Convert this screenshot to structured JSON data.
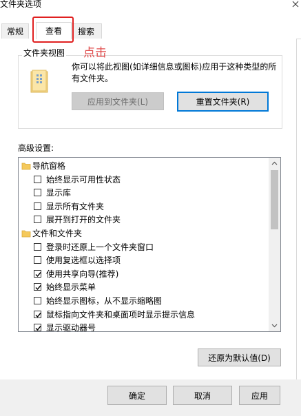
{
  "window": {
    "title": "文件夹选项"
  },
  "tabs": [
    {
      "label": "常规"
    },
    {
      "label": "查看"
    },
    {
      "label": "搜索"
    }
  ],
  "annotation": {
    "text": "点击"
  },
  "folder_views": {
    "legend": "文件夹视图",
    "description": "你可以将此视图(如详细信息或图标)应用于这种类型的所有文件夹。",
    "apply_label": "应用到文件夹(L)",
    "reset_label": "重置文件夹(R)"
  },
  "advanced": {
    "label": "高级设置:",
    "items": [
      {
        "type": "header",
        "text": "导航窗格",
        "icon": "navigation-pane-icon"
      },
      {
        "type": "check",
        "text": "始终显示可用性状态",
        "checked": false
      },
      {
        "type": "check",
        "text": "显示库",
        "checked": false
      },
      {
        "type": "check",
        "text": "显示所有文件夹",
        "checked": false
      },
      {
        "type": "check",
        "text": "展开到打开的文件夹",
        "checked": false
      },
      {
        "type": "header",
        "text": "文件和文件夹",
        "icon": "folder-icon"
      },
      {
        "type": "check",
        "text": "登录时还原上一个文件夹窗口",
        "checked": false
      },
      {
        "type": "check",
        "text": "使用复选框以选择项",
        "checked": false
      },
      {
        "type": "check",
        "text": "使用共享向导(推荐)",
        "checked": true
      },
      {
        "type": "check",
        "text": "始终显示菜单",
        "checked": true
      },
      {
        "type": "check",
        "text": "始终显示图标，从不显示缩略图",
        "checked": false
      },
      {
        "type": "check",
        "text": "鼠标指向文件夹和桌面项时显示提示信息",
        "checked": true
      },
      {
        "type": "check",
        "text": "显示驱动器号",
        "checked": true
      }
    ]
  },
  "buttons": {
    "restore_defaults": "还原为默认值(D)",
    "ok": "确定",
    "cancel": "取消",
    "apply": "应用"
  },
  "colors": {
    "accent": "#0078d7",
    "annotation": "#e02020"
  }
}
